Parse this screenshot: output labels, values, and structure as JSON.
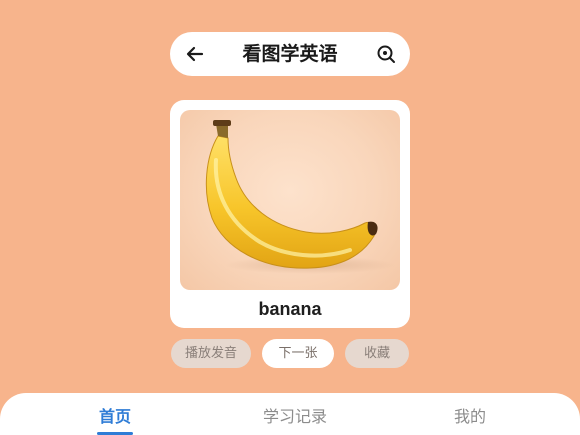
{
  "header": {
    "title": "看图学英语",
    "back_icon": "arrow-left-icon",
    "scan_icon": "scan-icon"
  },
  "card": {
    "image_subject": "banana-photo",
    "word": "banana"
  },
  "actions": {
    "play_label": "播放发音",
    "next_label": "下一张",
    "favorite_label": "收藏"
  },
  "tabs": [
    {
      "label": "首页",
      "active": true
    },
    {
      "label": "学习记录",
      "active": false
    },
    {
      "label": "我的",
      "active": false
    }
  ],
  "colors": {
    "background": "#f7b48c",
    "accent": "#2e7cd6",
    "card": "#ffffff"
  }
}
